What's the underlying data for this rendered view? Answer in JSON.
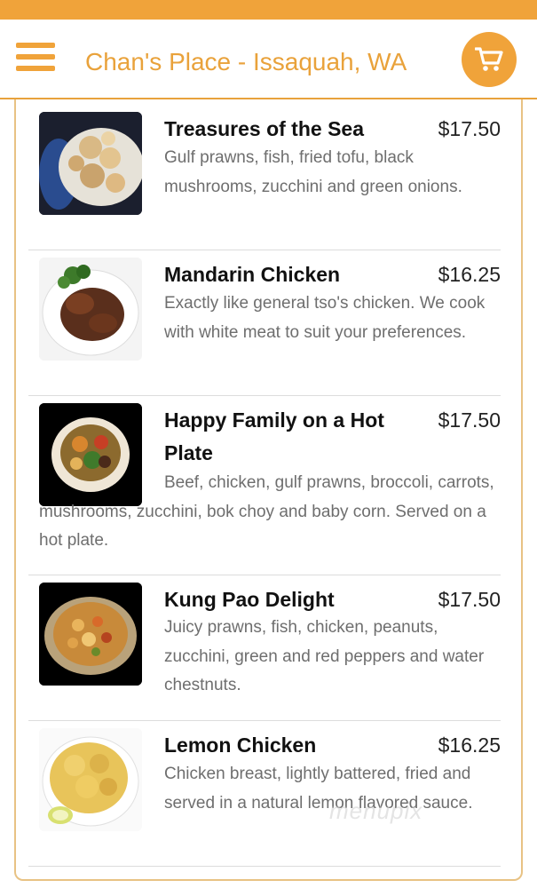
{
  "header": {
    "title": "Chan's Place - Issaquah, WA",
    "menu_icon": "hamburger-menu-icon",
    "cart_icon": "shopping-cart-icon",
    "accent_color": "#f0a33a"
  },
  "menu_items": [
    {
      "name": "Treasures of the Sea",
      "price": "$17.50",
      "description": "Gulf prawns, fish, fried tofu, black mushrooms, zucchini and green onions."
    },
    {
      "name": "Mandarin Chicken",
      "price": "$16.25",
      "description": "Exactly like general tso's chicken. We cook with white meat to suit your preferences."
    },
    {
      "name": "Happy Family on a Hot Plate",
      "price": "$17.50",
      "description": "Beef, chicken, gulf prawns, broccoli, carrots, mushrooms, zucchini, bok choy and baby corn. Served on a hot plate."
    },
    {
      "name": "Kung Pao Delight",
      "price": "$17.50",
      "description": "Juicy prawns, fish, chicken, peanuts, zucchini, green and red peppers and water chestnuts."
    },
    {
      "name": "Lemon Chicken",
      "price": "$16.25",
      "description": "Chicken breast, lightly battered, fried and served in a natural lemon flavored sauce."
    }
  ],
  "watermark": "menupix"
}
